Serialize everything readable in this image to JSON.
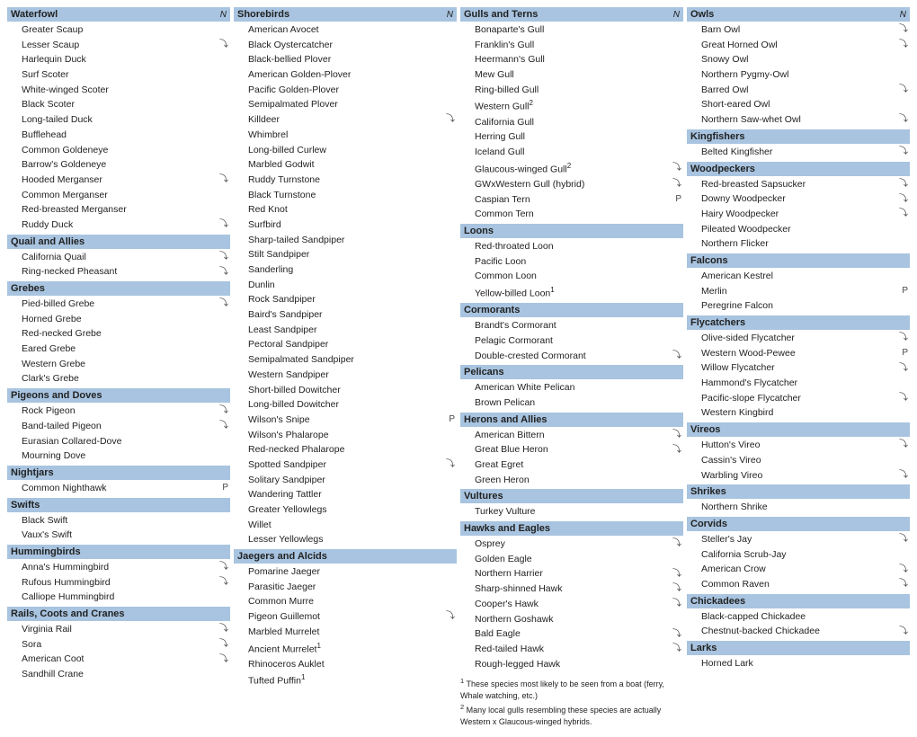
{
  "columns": [
    {
      "sections": [
        {
          "header": "Waterfowl",
          "showN": true,
          "species": [
            {
              "name": "Greater Scaup",
              "check": false
            },
            {
              "name": "Lesser Scaup",
              "check": true
            },
            {
              "name": "Harlequin Duck",
              "check": false
            },
            {
              "name": "Surf Scoter",
              "check": false
            },
            {
              "name": "White-winged Scoter",
              "check": false
            },
            {
              "name": "Black Scoter",
              "check": false
            },
            {
              "name": "Long-tailed Duck",
              "check": false
            },
            {
              "name": "Bufflehead",
              "check": false
            },
            {
              "name": "Common Goldeneye",
              "check": false
            },
            {
              "name": "Barrow's Goldeneye",
              "check": false
            },
            {
              "name": "Hooded Merganser",
              "check": true
            },
            {
              "name": "Common Merganser",
              "check": false
            },
            {
              "name": "Red-breasted Merganser",
              "check": false
            },
            {
              "name": "Ruddy Duck",
              "check": true
            }
          ]
        },
        {
          "header": "Quail and Allies",
          "showN": false,
          "species": [
            {
              "name": "California Quail",
              "check": true
            },
            {
              "name": "Ring-necked Pheasant",
              "check": true
            }
          ]
        },
        {
          "header": "Grebes",
          "showN": false,
          "species": [
            {
              "name": "Pied-billed Grebe",
              "check": true
            },
            {
              "name": "Horned Grebe",
              "check": false
            },
            {
              "name": "Red-necked Grebe",
              "check": false
            },
            {
              "name": "Eared Grebe",
              "check": false
            },
            {
              "name": "Western Grebe",
              "check": false
            },
            {
              "name": "Clark's Grebe",
              "check": false
            }
          ]
        },
        {
          "header": "Pigeons and Doves",
          "showN": false,
          "species": [
            {
              "name": "Rock Pigeon",
              "check": true
            },
            {
              "name": "Band-tailed Pigeon",
              "check": true
            },
            {
              "name": "Eurasian Collared-Dove",
              "check": false
            },
            {
              "name": "Mourning Dove",
              "check": false
            }
          ]
        },
        {
          "header": "Nightjars",
          "showN": false,
          "species": [
            {
              "name": "Common Nighthawk",
              "check": false,
              "tag": "P"
            }
          ]
        },
        {
          "header": "Swifts",
          "showN": false,
          "species": [
            {
              "name": "Black Swift",
              "check": false
            },
            {
              "name": "Vaux's Swift",
              "check": false
            }
          ]
        },
        {
          "header": "Hummingbirds",
          "showN": false,
          "species": [
            {
              "name": "Anna's Hummingbird",
              "check": true
            },
            {
              "name": "Rufous Hummingbird",
              "check": true
            },
            {
              "name": "Calliope Hummingbird",
              "check": false
            }
          ]
        },
        {
          "header": "Rails, Coots and Cranes",
          "showN": false,
          "species": [
            {
              "name": "Virginia Rail",
              "check": true
            },
            {
              "name": "Sora",
              "check": true
            },
            {
              "name": "American Coot",
              "check": true
            },
            {
              "name": "Sandhill Crane",
              "check": false
            }
          ]
        }
      ]
    },
    {
      "sections": [
        {
          "header": "Shorebirds",
          "showN": true,
          "species": [
            {
              "name": "American Avocet",
              "check": false
            },
            {
              "name": "Black Oystercatcher",
              "check": false
            },
            {
              "name": "Black-bellied Plover",
              "check": false
            },
            {
              "name": "American Golden-Plover",
              "check": false
            },
            {
              "name": "Pacific Golden-Plover",
              "check": false
            },
            {
              "name": "Semipalmated Plover",
              "check": false
            },
            {
              "name": "Killdeer",
              "check": true
            },
            {
              "name": "Whimbrel",
              "check": false
            },
            {
              "name": "Long-billed Curlew",
              "check": false
            },
            {
              "name": "Marbled Godwit",
              "check": false
            },
            {
              "name": "Ruddy Turnstone",
              "check": false
            },
            {
              "name": "Black Turnstone",
              "check": false
            },
            {
              "name": "Red Knot",
              "check": false
            },
            {
              "name": "Surfbird",
              "check": false
            },
            {
              "name": "Sharp-tailed Sandpiper",
              "check": false
            },
            {
              "name": "Stilt Sandpiper",
              "check": false
            },
            {
              "name": "Sanderling",
              "check": false
            },
            {
              "name": "Dunlin",
              "check": false
            },
            {
              "name": "Rock Sandpiper",
              "check": false
            },
            {
              "name": "Baird's Sandpiper",
              "check": false
            },
            {
              "name": "Least Sandpiper",
              "check": false
            },
            {
              "name": "Pectoral Sandpiper",
              "check": false
            },
            {
              "name": "Semipalmated Sandpiper",
              "check": false
            },
            {
              "name": "Western Sandpiper",
              "check": false
            },
            {
              "name": "Short-billed Dowitcher",
              "check": false
            },
            {
              "name": "Long-billed Dowitcher",
              "check": false
            },
            {
              "name": "Wilson's Snipe",
              "check": false,
              "tag": "P"
            },
            {
              "name": "Wilson's Phalarope",
              "check": false
            },
            {
              "name": "Red-necked Phalarope",
              "check": false
            },
            {
              "name": "Spotted Sandpiper",
              "check": true
            },
            {
              "name": "Solitary Sandpiper",
              "check": false
            },
            {
              "name": "Wandering Tattler",
              "check": false
            },
            {
              "name": "Greater Yellowlegs",
              "check": false
            },
            {
              "name": "Willet",
              "check": false
            },
            {
              "name": "Lesser Yellowlegs",
              "check": false
            }
          ]
        },
        {
          "header": "Jaegers and Alcids",
          "showN": false,
          "species": [
            {
              "name": "Pomarine Jaeger",
              "check": false
            },
            {
              "name": "Parasitic Jaeger",
              "check": false
            },
            {
              "name": "Common Murre",
              "check": false
            },
            {
              "name": "Pigeon Guillemot",
              "check": true
            },
            {
              "name": "Marbled Murrelet",
              "check": false
            },
            {
              "name": "Ancient Murrelet",
              "check": false,
              "sup": "1"
            },
            {
              "name": "Rhinoceros Auklet",
              "check": false
            },
            {
              "name": "Tufted Puffin",
              "check": false,
              "sup": "1"
            }
          ]
        }
      ]
    },
    {
      "sections": [
        {
          "header": "Gulls and Terns",
          "showN": true,
          "species": [
            {
              "name": "Bonaparte's Gull",
              "check": false
            },
            {
              "name": "Franklin's Gull",
              "check": false
            },
            {
              "name": "Heermann's Gull",
              "check": false
            },
            {
              "name": "Mew Gull",
              "check": false
            },
            {
              "name": "Ring-billed Gull",
              "check": false
            },
            {
              "name": "Western Gull",
              "check": false,
              "sup": "2"
            },
            {
              "name": "California Gull",
              "check": false
            },
            {
              "name": "Herring Gull",
              "check": false
            },
            {
              "name": "Iceland Gull",
              "check": false
            },
            {
              "name": "Glaucous-winged Gull",
              "check": true,
              "sup": "2"
            },
            {
              "name": "GWxWestern Gull (hybrid)",
              "check": true
            },
            {
              "name": "Caspian Tern",
              "check": false,
              "tag": "P"
            },
            {
              "name": "Common Tern",
              "check": false
            }
          ]
        },
        {
          "header": "Loons",
          "showN": false,
          "species": [
            {
              "name": "Red-throated Loon",
              "check": false
            },
            {
              "name": "Pacific Loon",
              "check": false
            },
            {
              "name": "Common Loon",
              "check": false
            },
            {
              "name": "Yellow-billed Loon",
              "check": false,
              "sup": "1"
            }
          ]
        },
        {
          "header": "Cormorants",
          "showN": false,
          "species": [
            {
              "name": "Brandt's Cormorant",
              "check": false
            },
            {
              "name": "Pelagic Cormorant",
              "check": false
            },
            {
              "name": "Double-crested Cormorant",
              "check": true
            }
          ]
        },
        {
          "header": "Pelicans",
          "showN": false,
          "species": [
            {
              "name": "American White Pelican",
              "check": false
            },
            {
              "name": "Brown Pelican",
              "check": false
            }
          ]
        },
        {
          "header": "Herons and Allies",
          "showN": false,
          "species": [
            {
              "name": "American Bittern",
              "check": true
            },
            {
              "name": "Great Blue Heron",
              "check": true
            },
            {
              "name": "Great Egret",
              "check": false
            },
            {
              "name": "Green Heron",
              "check": false
            }
          ]
        },
        {
          "header": "Vultures",
          "showN": false,
          "species": [
            {
              "name": "Turkey Vulture",
              "check": false
            }
          ]
        },
        {
          "header": "Hawks and Eagles",
          "showN": false,
          "species": [
            {
              "name": "Osprey",
              "check": true
            },
            {
              "name": "Golden Eagle",
              "check": false
            },
            {
              "name": "Northern Harrier",
              "check": true
            },
            {
              "name": "Sharp-shinned Hawk",
              "check": true
            },
            {
              "name": "Cooper's Hawk",
              "check": true
            },
            {
              "name": "Northern Goshawk",
              "check": false
            },
            {
              "name": "Bald Eagle",
              "check": true
            },
            {
              "name": "Red-tailed Hawk",
              "check": true
            },
            {
              "name": "Rough-legged Hawk",
              "check": false
            }
          ]
        }
      ],
      "footnotes": [
        {
          "sup": "1",
          "text": "These species most likely to be seen from a boat (ferry, Whale watching, etc.)"
        },
        {
          "sup": "2",
          "text": "Many local gulls resembling these species are actually Western x Glaucous-winged hybrids."
        }
      ]
    },
    {
      "sections": [
        {
          "header": "Owls",
          "showN": true,
          "species": [
            {
              "name": "Barn Owl",
              "check": true
            },
            {
              "name": "Great Horned Owl",
              "check": true
            },
            {
              "name": "Snowy Owl",
              "check": false
            },
            {
              "name": "Northern Pygmy-Owl",
              "check": false
            },
            {
              "name": "Barred Owl",
              "check": true
            },
            {
              "name": "Short-eared Owl",
              "check": false
            },
            {
              "name": "Northern Saw-whet Owl",
              "check": true
            }
          ]
        },
        {
          "header": "Kingfishers",
          "showN": false,
          "species": [
            {
              "name": "Belted Kingfisher",
              "check": true
            }
          ]
        },
        {
          "header": "Woodpeckers",
          "showN": false,
          "species": [
            {
              "name": "Red-breasted Sapsucker",
              "check": true
            },
            {
              "name": "Downy Woodpecker",
              "check": true
            },
            {
              "name": "Hairy Woodpecker",
              "check": true
            },
            {
              "name": "Pileated Woodpecker",
              "check": false
            },
            {
              "name": "Northern Flicker",
              "check": false
            }
          ]
        },
        {
          "header": "Falcons",
          "showN": false,
          "species": [
            {
              "name": "American Kestrel",
              "check": false
            },
            {
              "name": "Merlin",
              "check": false,
              "tag": "P"
            },
            {
              "name": "Peregrine Falcon",
              "check": false
            }
          ]
        },
        {
          "header": "Flycatchers",
          "showN": false,
          "species": [
            {
              "name": "Olive-sided Flycatcher",
              "check": true
            },
            {
              "name": "Western Wood-Pewee",
              "check": false,
              "tag": "P"
            },
            {
              "name": "Willow Flycatcher",
              "check": true
            },
            {
              "name": "Hammond's Flycatcher",
              "check": false
            },
            {
              "name": "Pacific-slope Flycatcher",
              "check": true
            },
            {
              "name": "Western Kingbird",
              "check": false
            }
          ]
        },
        {
          "header": "Vireos",
          "showN": false,
          "species": [
            {
              "name": "Hutton's Vireo",
              "check": true
            },
            {
              "name": "Cassin's Vireo",
              "check": false
            },
            {
              "name": "Warbling Vireo",
              "check": true
            }
          ]
        },
        {
          "header": "Shrikes",
          "showN": false,
          "species": [
            {
              "name": "Northern Shrike",
              "check": false
            }
          ]
        },
        {
          "header": "Corvids",
          "showN": false,
          "species": [
            {
              "name": "Steller's Jay",
              "check": true
            },
            {
              "name": "California Scrub-Jay",
              "check": false
            },
            {
              "name": "American Crow",
              "check": true
            },
            {
              "name": "Common Raven",
              "check": true
            }
          ]
        },
        {
          "header": "Chickadees",
          "showN": false,
          "species": [
            {
              "name": "Black-capped Chickadee",
              "check": false
            },
            {
              "name": "Chestnut-backed Chickadee",
              "check": true
            }
          ]
        },
        {
          "header": "Larks",
          "showN": false,
          "species": [
            {
              "name": "Horned Lark",
              "check": false
            }
          ]
        }
      ]
    }
  ]
}
